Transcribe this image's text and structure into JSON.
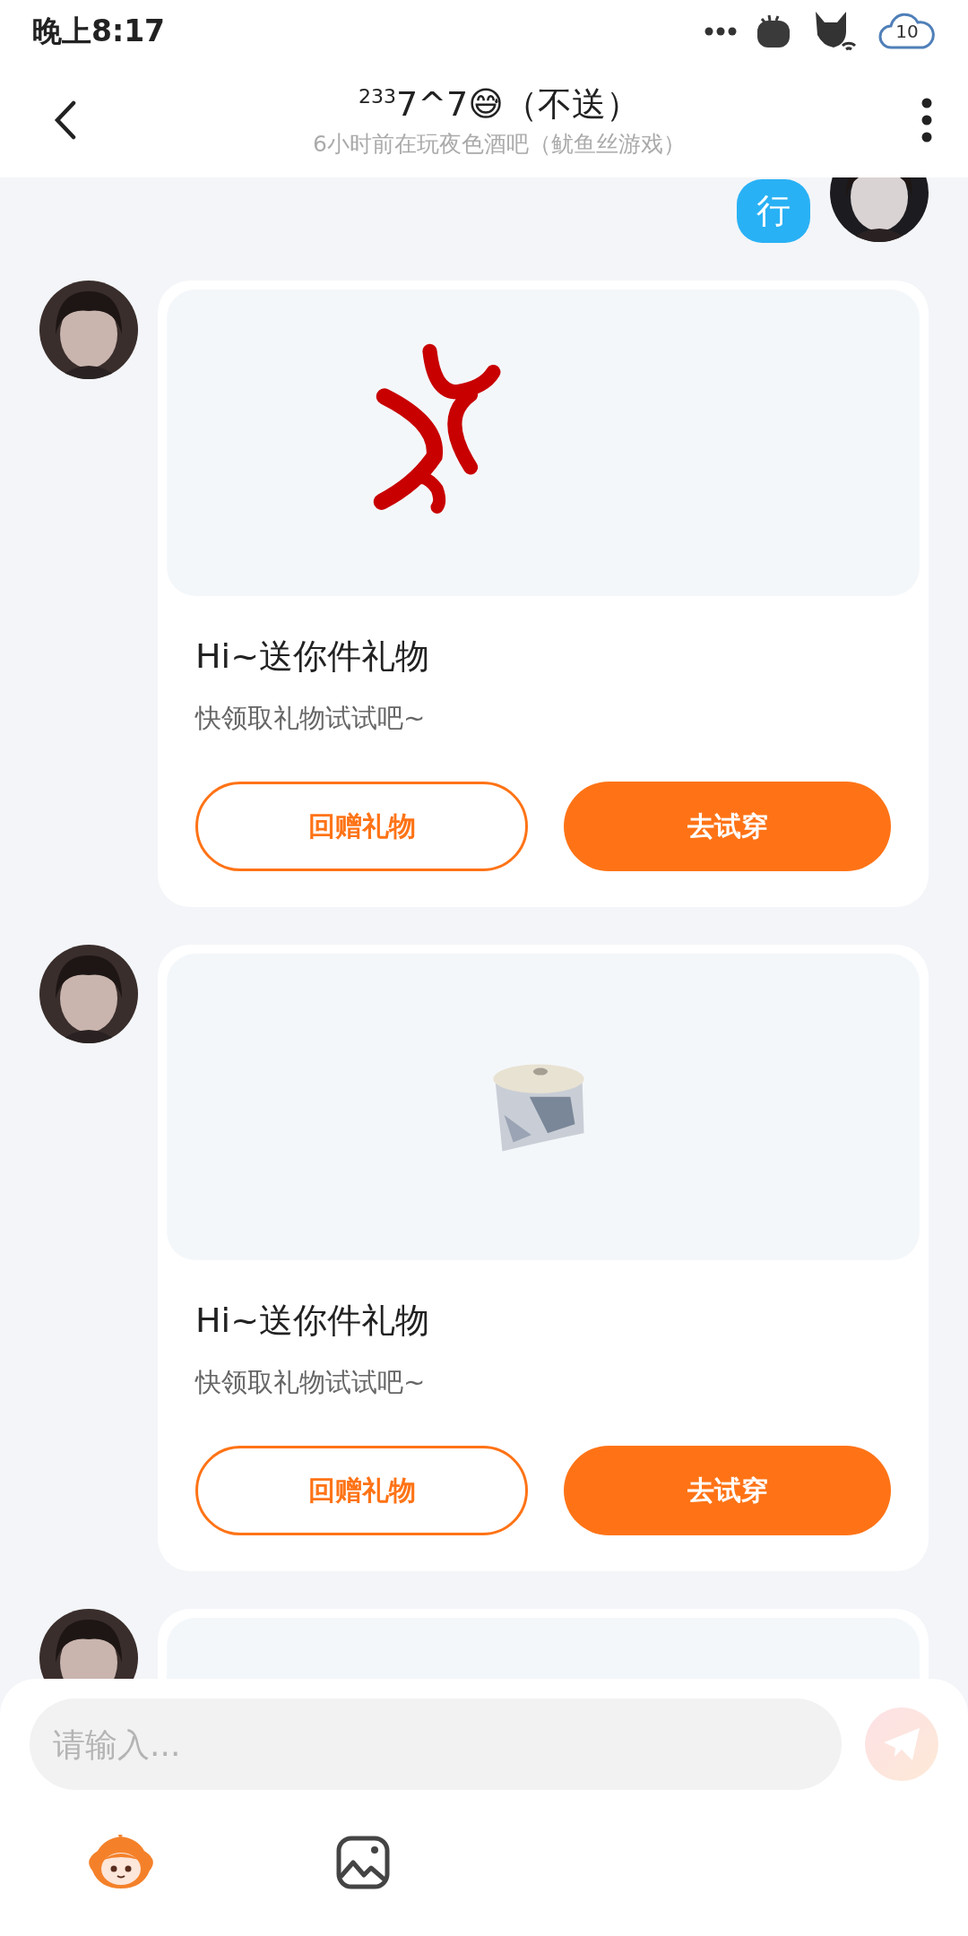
{
  "status_bar": {
    "time": "晚上8:17",
    "cloud_badge": "10"
  },
  "header": {
    "title": "$^{233}$7^7😅（不送）",
    "subtitle": "6小时前在玩夜色酒吧（鱿鱼丝游戏）"
  },
  "messages": [
    {
      "kind": "text",
      "outgoing": true,
      "text": "行"
    },
    {
      "kind": "gift",
      "outgoing": false,
      "title": "Hi~送你件礼物",
      "subtitle": "快领取礼物试试吧~",
      "buttons": [
        {
          "label": "回赠礼物",
          "kind": "outline"
        },
        {
          "label": "去试穿",
          "kind": "filled"
        }
      ]
    },
    {
      "kind": "gift",
      "outgoing": false,
      "title": "Hi~送你件礼物",
      "subtitle": "快领取礼物试试吧~",
      "buttons": [
        {
          "label": "回赠礼物",
          "kind": "outline"
        },
        {
          "label": "去试穿",
          "kind": "filled"
        }
      ]
    },
    {
      "kind": "gift",
      "outgoing": false
    }
  ],
  "input": {
    "placeholder": "请输入..."
  }
}
